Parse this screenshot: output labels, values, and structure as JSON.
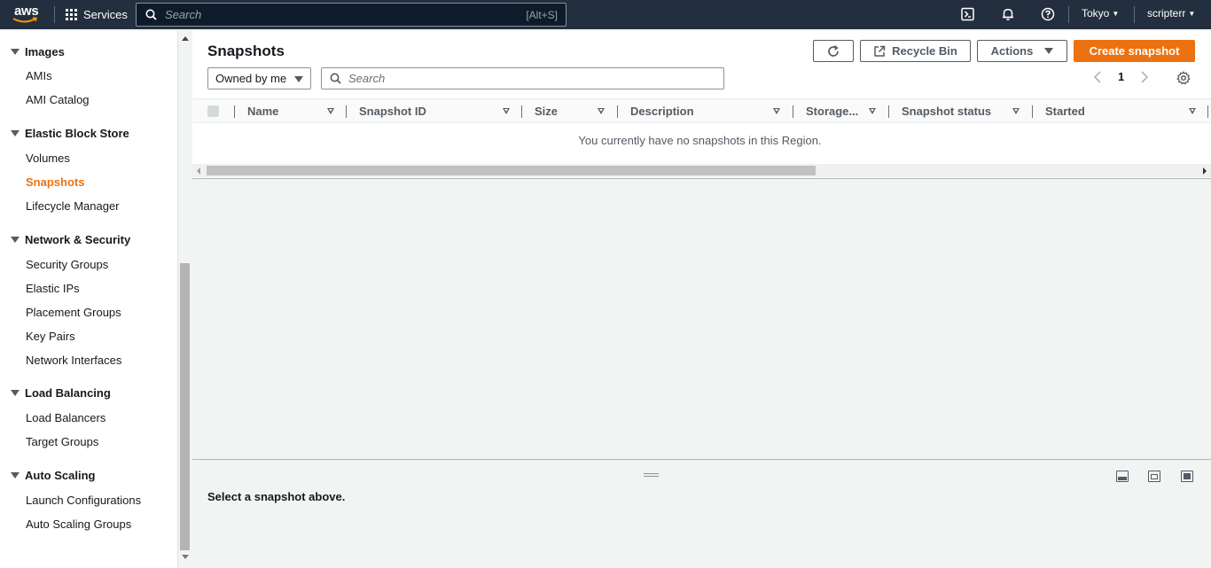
{
  "topnav": {
    "logo_text": "aws",
    "services_label": "Services",
    "search_placeholder": "Search",
    "search_shortcut": "[Alt+S]",
    "region": "Tokyo",
    "user": "scripterr"
  },
  "sidebar": {
    "sections": [
      {
        "title": "Images",
        "items": [
          {
            "label": "AMIs"
          },
          {
            "label": "AMI Catalog"
          }
        ]
      },
      {
        "title": "Elastic Block Store",
        "items": [
          {
            "label": "Volumes"
          },
          {
            "label": "Snapshots",
            "active": true
          },
          {
            "label": "Lifecycle Manager"
          }
        ]
      },
      {
        "title": "Network & Security",
        "items": [
          {
            "label": "Security Groups"
          },
          {
            "label": "Elastic IPs"
          },
          {
            "label": "Placement Groups"
          },
          {
            "label": "Key Pairs"
          },
          {
            "label": "Network Interfaces"
          }
        ]
      },
      {
        "title": "Load Balancing",
        "items": [
          {
            "label": "Load Balancers"
          },
          {
            "label": "Target Groups"
          }
        ]
      },
      {
        "title": "Auto Scaling",
        "items": [
          {
            "label": "Launch Configurations"
          },
          {
            "label": "Auto Scaling Groups"
          }
        ]
      }
    ]
  },
  "main": {
    "title": "Snapshots",
    "recycle_bin_label": "Recycle Bin",
    "actions_label": "Actions",
    "create_label": "Create snapshot",
    "owner_filter": "Owned by me",
    "search_placeholder": "Search",
    "page_number": "1",
    "columns": [
      "Name",
      "Snapshot ID",
      "Size",
      "Description",
      "Storage...",
      "Snapshot status",
      "Started"
    ],
    "empty_message": "You currently have no snapshots in this Region."
  },
  "split_panel": {
    "message": "Select a snapshot above."
  },
  "colors": {
    "nav_bg": "#232f3e",
    "accent": "#ec7211"
  }
}
